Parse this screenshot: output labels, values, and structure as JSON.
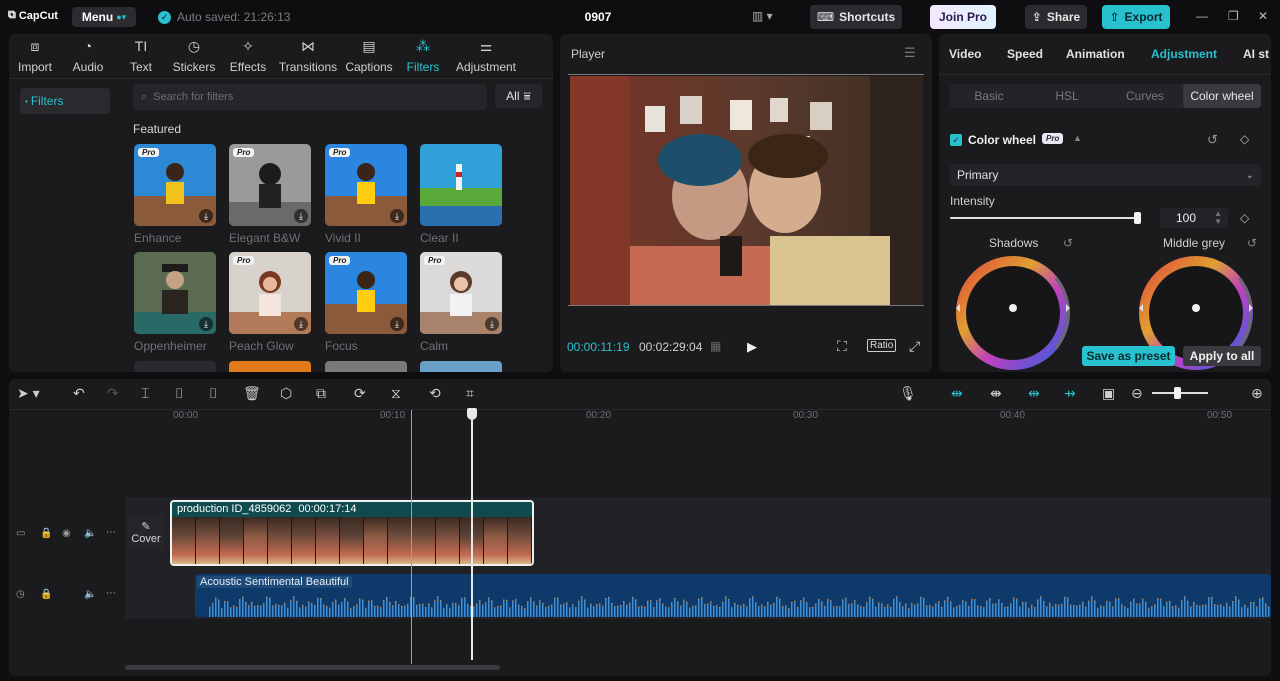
{
  "titlebar": {
    "logo": "CapCut",
    "menu_label": "Menu",
    "autosave": "Auto saved: 21:26:13",
    "project_title": "0907",
    "shortcuts_label": "Shortcuts",
    "joinpro_label": "Join Pro",
    "share_label": "Share",
    "export_label": "Export"
  },
  "media": {
    "tabs": [
      {
        "label": "Import",
        "icon": "import-icon"
      },
      {
        "label": "Audio",
        "icon": "audio-icon"
      },
      {
        "label": "Text",
        "icon": "text-icon"
      },
      {
        "label": "Stickers",
        "icon": "sticker-icon"
      },
      {
        "label": "Effects",
        "icon": "effects-icon"
      },
      {
        "label": "Transitions",
        "icon": "transitions-icon"
      },
      {
        "label": "Captions",
        "icon": "captions-icon"
      },
      {
        "label": "Filters",
        "icon": "filters-icon"
      },
      {
        "label": "Adjustment",
        "icon": "adjustment-icon"
      }
    ],
    "active_tab": "Filters",
    "sidebar_item": "Filters",
    "search_placeholder": "Search for filters",
    "all_label": "All",
    "section_title": "Featured",
    "filters": [
      {
        "name": "Enhance",
        "pro": "Pro"
      },
      {
        "name": "Elegant B&W",
        "pro": "Pro"
      },
      {
        "name": "Vivid II",
        "pro": "Pro"
      },
      {
        "name": "Clear II",
        "pro": ""
      },
      {
        "name": "Oppenheimer",
        "pro": ""
      },
      {
        "name": "Peach Glow",
        "pro": "Pro"
      },
      {
        "name": "Focus",
        "pro": "Pro"
      },
      {
        "name": "Calm",
        "pro": "Pro"
      }
    ]
  },
  "player": {
    "title": "Player",
    "current_time": "00:00:11:19",
    "total_time": "00:02:29:04",
    "ratio_label": "Ratio"
  },
  "inspector": {
    "tabs": [
      "Video",
      "Speed",
      "Animation",
      "Adjustment",
      "AI st"
    ],
    "active_tab": "Adjustment",
    "subtabs": [
      "Basic",
      "HSL",
      "Curves",
      "Color wheel"
    ],
    "active_subtab": "Color wheel",
    "colorwheel_title": "Color wheel",
    "pro_badge": "Pro",
    "select_value": "Primary",
    "intensity_label": "Intensity",
    "intensity_value": "100",
    "intensity_fraction": 0.99,
    "wheels": [
      "Shadows",
      "Middle grey"
    ],
    "save_preset_label": "Save as preset",
    "apply_all_label": "Apply to all"
  },
  "timeline": {
    "ruler": [
      "00:00",
      "00:10",
      "00:20",
      "00:30",
      "00:40",
      "00:50"
    ],
    "cover_label": "Cover",
    "video_clip": {
      "name": "production ID_4859062",
      "duration": "00:00:17:14"
    },
    "audio_clip": {
      "name": "Acoustic Sentimental Beautiful"
    }
  },
  "colors": {
    "accent": "#27c2ce",
    "panel": "#1b1b1e",
    "background": "#0e0e10",
    "audio_clip": "#0d3a6b",
    "video_clip": "#0f4a4f"
  }
}
